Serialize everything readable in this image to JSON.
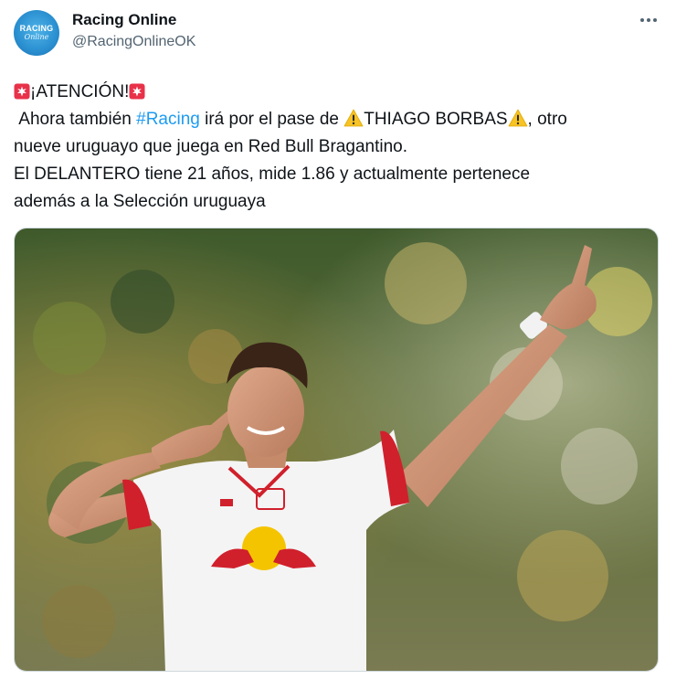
{
  "author": {
    "name": "Racing Online",
    "handle": "@RacingOnlineOK",
    "avatar_text_top": "RACING",
    "avatar_text_bottom": "Online"
  },
  "tweet": {
    "headline": "¡ATENCIÓN!",
    "line2_before": "Ahora también ",
    "hashtag": "#Racing",
    "line2_middle": " irá por el pase de ",
    "player_name": "THIAGO BORBAS",
    "line2_after": ", otro",
    "line3": "nueve uruguayo que juega en Red Bull Bragantino.",
    "line4": "El DELANTERO tiene 21 años, mide 1.86 y actualmente pertenece",
    "line5": "además a la Selección uruguaya"
  },
  "icons": {
    "headline_emoji": "police-siren-icon",
    "name_emoji": "warning-icon",
    "menu": "more-options-icon"
  },
  "colors": {
    "link": "#1d9bf0",
    "secondary_text": "#536471",
    "jersey_red": "#d0202c",
    "logo_yellow": "#f5c400"
  }
}
